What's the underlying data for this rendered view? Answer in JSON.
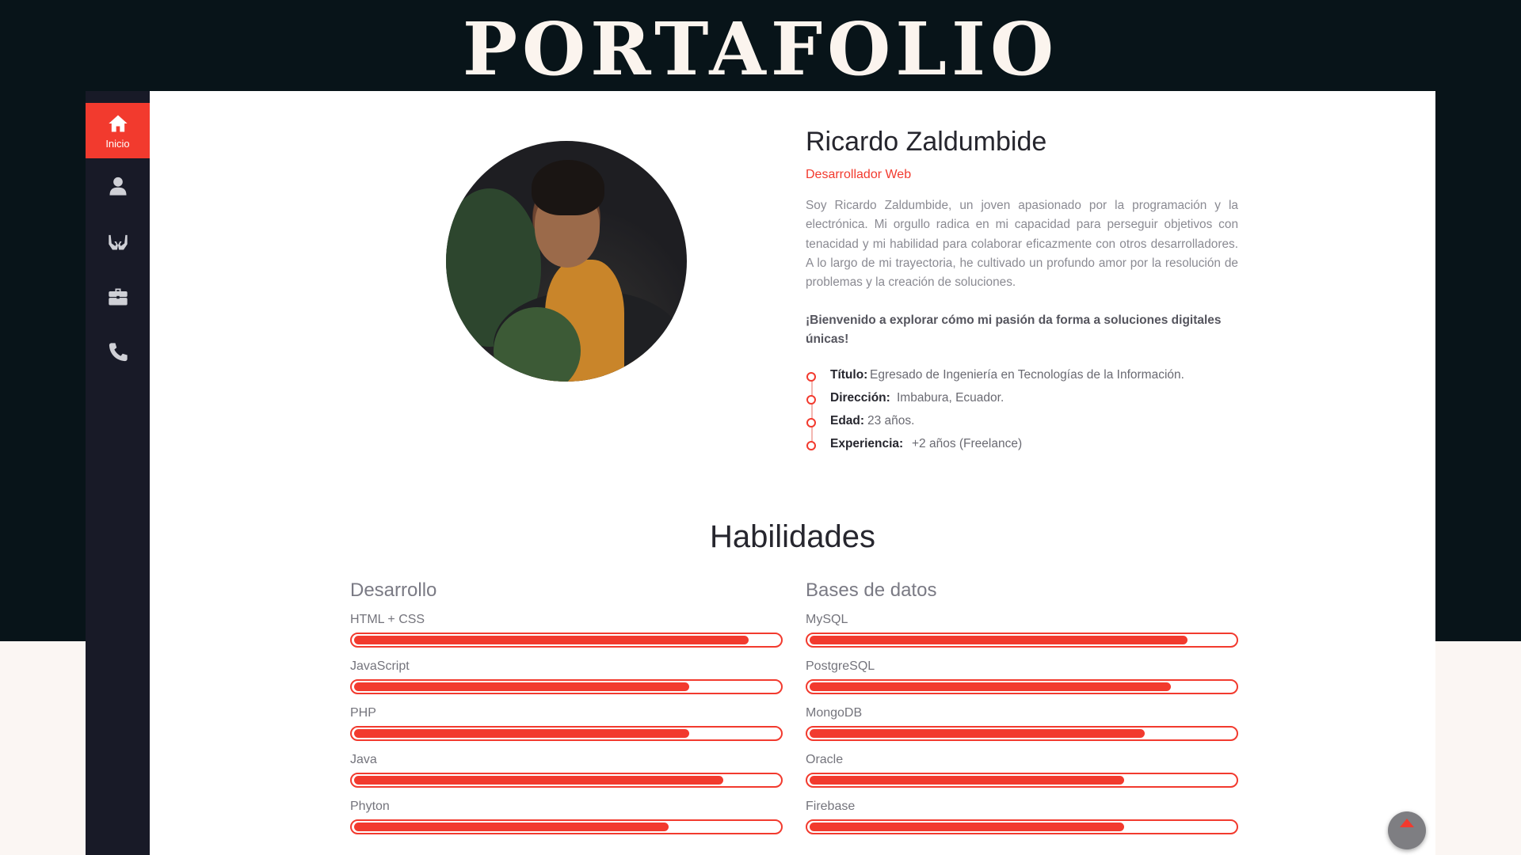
{
  "header": {
    "title": "PORTAFOLIO"
  },
  "sidebar": {
    "items": [
      {
        "label": "Inicio",
        "icon": "home-icon",
        "active": true
      },
      {
        "label": "",
        "icon": "user-icon"
      },
      {
        "label": "",
        "icon": "hands-icon"
      },
      {
        "label": "",
        "icon": "briefcase-icon"
      },
      {
        "label": "",
        "icon": "phone-icon"
      }
    ]
  },
  "profile": {
    "name": "Ricardo Zaldumbide",
    "role": "Desarrollador Web",
    "bio": "Soy Ricardo Zaldumbide, un joven apasionado por la programación y la electrónica. Mi orgullo radica en mi capacidad para perseguir objetivos con tenacidad y mi habilidad para colaborar eficazmente con otros desarrolladores. A lo largo de mi trayectoria, he cultivado un profundo amor por la resolución de problemas y la creación de soluciones.",
    "welcome": "¡Bienvenido a explorar cómo mi pasión da forma a soluciones digitales únicas!",
    "facts": [
      {
        "label": "Título:",
        "value": "Egresado de Ingeniería en Tecnologías de la Información."
      },
      {
        "label": "Dirección:",
        "value": "Imbabura, Ecuador."
      },
      {
        "label": "Edad:",
        "value": "23 años."
      },
      {
        "label": "Experiencia:",
        "value": "+2 años (Freelance)"
      }
    ]
  },
  "skills": {
    "title": "Habilidades",
    "columns": [
      {
        "title": "Desarrollo",
        "items": [
          {
            "name": "HTML + CSS",
            "level": 0.93
          },
          {
            "name": "JavaScript",
            "level": 0.79
          },
          {
            "name": "PHP",
            "level": 0.79
          },
          {
            "name": "Java",
            "level": 0.87
          },
          {
            "name": "Phyton",
            "level": 0.74
          }
        ]
      },
      {
        "title": "Bases de datos",
        "items": [
          {
            "name": "MySQL",
            "level": 0.89
          },
          {
            "name": "PostgreSQL",
            "level": 0.85
          },
          {
            "name": "MongoDB",
            "level": 0.79
          },
          {
            "name": "Oracle",
            "level": 0.74
          },
          {
            "name": "Firebase",
            "level": 0.74
          }
        ]
      }
    ]
  },
  "colors": {
    "accent": "#f23a2e",
    "sidebar": "#181a27",
    "header": "#081419"
  }
}
